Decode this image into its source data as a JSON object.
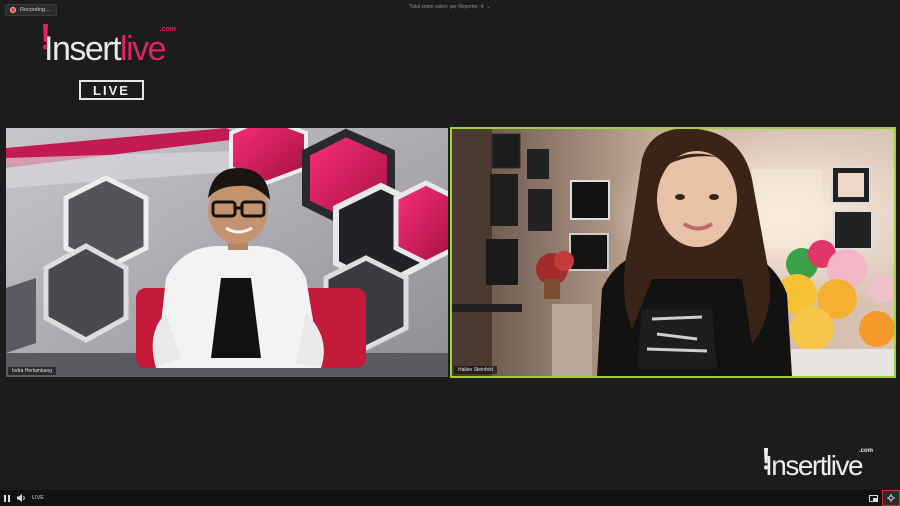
{
  "recording": {
    "label": "Recording..."
  },
  "view": {
    "title": "Total zoom video: per Reporter: 4"
  },
  "logo": {
    "insert": "Insert",
    "live": "live",
    "com": ".com",
    "badge": "LIVE"
  },
  "participants": [
    {
      "name": "Indra Herlambang"
    },
    {
      "name": "Hailee Steinfeld"
    }
  ],
  "controls": {
    "live_label": "LIVE"
  },
  "icons": {
    "pause": "pause-icon",
    "volume": "volume-icon",
    "pip": "picture-in-picture-icon",
    "settings": "settings-icon"
  }
}
